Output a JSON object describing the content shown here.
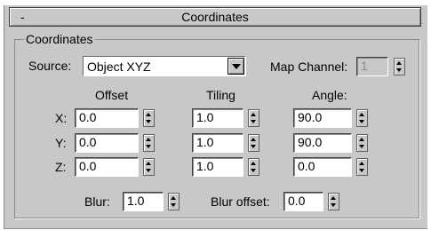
{
  "rollout": {
    "toggle": "-",
    "title": "Coordinates"
  },
  "group": {
    "label": "Coordinates"
  },
  "source": {
    "label": "Source:",
    "value": "Object XYZ"
  },
  "map_channel": {
    "label": "Map Channel:",
    "value": "1"
  },
  "columns": {
    "offset": "Offset",
    "tiling": "Tiling",
    "angle": "Angle:"
  },
  "rows": [
    {
      "label": "X:",
      "offset": "0.0",
      "tiling": "1.0",
      "angle": "90.0"
    },
    {
      "label": "Y:",
      "offset": "0.0",
      "tiling": "1.0",
      "angle": "90.0"
    },
    {
      "label": "Z:",
      "offset": "0.0",
      "tiling": "1.0",
      "angle": "0.0"
    }
  ],
  "blur": {
    "label": "Blur:",
    "value": "1.0"
  },
  "blur_offset": {
    "label": "Blur offset:",
    "value": "0.0"
  }
}
